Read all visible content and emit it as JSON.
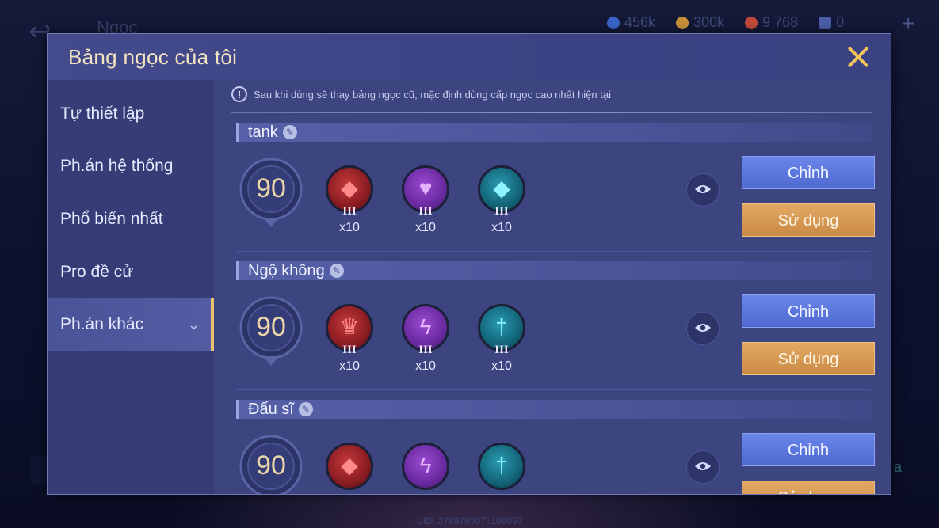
{
  "background": {
    "title": "Ngọc",
    "resources": [
      {
        "icon": "diamond-icon",
        "value": "456k",
        "color": "#3a63c8"
      },
      {
        "icon": "coin-icon",
        "value": "300k",
        "color": "#c9903a"
      },
      {
        "icon": "voucher-icon",
        "value": "9 768",
        "color": "#c24a3a"
      },
      {
        "icon": "ticket-icon",
        "value": "0",
        "color": "#4a5fa8"
      }
    ],
    "uid": "UID: 2788794072106097",
    "right_text": "a"
  },
  "modal": {
    "title": "Bảng ngọc của tôi",
    "close_icon": "close-icon"
  },
  "sidebar": {
    "items": [
      {
        "label": "Tự thiết lập",
        "active": false
      },
      {
        "label": "Ph.án hệ thống",
        "active": false
      },
      {
        "label": "Phổ biến nhất",
        "active": false
      },
      {
        "label": "Pro đề cử",
        "active": false
      },
      {
        "label": "Ph.án khác",
        "active": true
      }
    ]
  },
  "notice": {
    "text": "Sau khi dùng sẽ thay bảng ngọc cũ, mặc định dùng cấp ngọc cao nhất hiện tại",
    "icon": "!"
  },
  "rune_sets": [
    {
      "name": "tank",
      "level": "90",
      "runes": [
        {
          "color": "red",
          "icon": "red-crystal-icon",
          "tier": "III",
          "qty": "x10"
        },
        {
          "color": "purple",
          "icon": "purple-heart-icon",
          "tier": "III",
          "qty": "x10"
        },
        {
          "color": "teal",
          "icon": "teal-crystal-icon",
          "tier": "III",
          "qty": "x10"
        }
      ],
      "edit_label": "Chỉnh",
      "use_label": "Sử dụng"
    },
    {
      "name": "Ngộ không",
      "level": "90",
      "runes": [
        {
          "color": "red",
          "icon": "red-crown-icon",
          "tier": "III",
          "qty": "x10"
        },
        {
          "color": "purple",
          "icon": "purple-lightning-icon",
          "tier": "III",
          "qty": "x10"
        },
        {
          "color": "teal",
          "icon": "teal-sword-icon",
          "tier": "III",
          "qty": "x10"
        }
      ],
      "edit_label": "Chỉnh",
      "use_label": "Sử dụng"
    },
    {
      "name": "Đấu sĩ",
      "level": "90",
      "runes": [
        {
          "color": "red",
          "icon": "red-crystal-icon",
          "tier": "",
          "qty": ""
        },
        {
          "color": "purple",
          "icon": "purple-lightning-icon",
          "tier": "",
          "qty": ""
        },
        {
          "color": "teal",
          "icon": "teal-sword-icon",
          "tier": "",
          "qty": ""
        }
      ],
      "edit_label": "Chỉnh",
      "use_label": "Sử dụng"
    }
  ]
}
